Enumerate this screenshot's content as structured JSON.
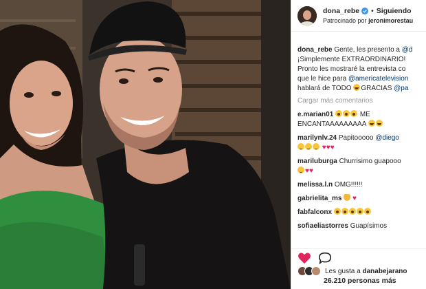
{
  "header": {
    "username": "dona_rebe",
    "separator": "•",
    "follow_label": "Siguiendo",
    "sponsored_prefix": "Patrocinado por",
    "sponsor": "jeronimorestau"
  },
  "caption": {
    "username": "dona_rebe",
    "line1": "Gente, les presento a",
    "line1_mention": "@d",
    "line2": "¡Simplemente EXTRAORDINARIO!",
    "line3": "Pronto les mostraré la entrevista co",
    "line4_prefix": "que le hice para",
    "line4_mention": "@americatelevision",
    "line5_prefix": "hablará de TODO",
    "line5_word": "GRACIAS",
    "line5_mention": "@pa"
  },
  "load_more_label": "Cargar más comentarios",
  "comments": [
    {
      "user": "e.marian01",
      "text1": "ME",
      "text2": "ENCANTAAAAAAAAA"
    },
    {
      "user": "marilynlv.24",
      "text1": "Papitooooo",
      "mention": "@diego"
    },
    {
      "user": "mariluburga",
      "text1": "Churrisimo guapooo"
    },
    {
      "user": "melissa.l.n",
      "text1": "OMG!!!!!!"
    },
    {
      "user": "gabrielita_ms"
    },
    {
      "user": "fabfalconx"
    },
    {
      "user": "sofiaeliastorres",
      "text1": "Guapísimos"
    }
  ],
  "likes": {
    "prefix": "Les gusta a",
    "user": "danabejarano",
    "count_line": "26.210 personas más"
  },
  "colors": {
    "link": "#003569",
    "heart": "#e0245e",
    "verified": "#3897f0",
    "muted": "#999999"
  },
  "icons": [
    "verified-badge-icon",
    "heart-icon",
    "comment-icon",
    "emoji-icon"
  ]
}
